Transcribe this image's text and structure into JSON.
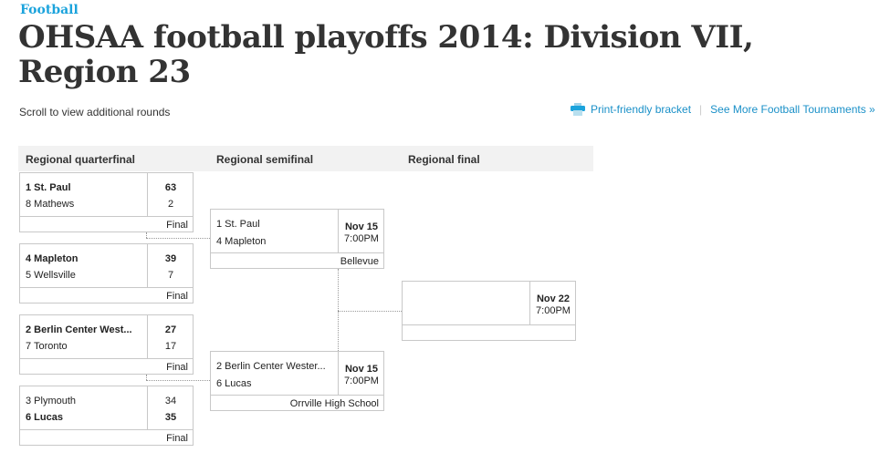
{
  "header": {
    "category": "Football",
    "title": "OHSAA football playoffs 2014: Division VII, Region 23",
    "scroll_note": "Scroll to view additional rounds",
    "print_link": "Print-friendly bracket",
    "more_link": "See More Football Tournaments »",
    "separator": "|"
  },
  "rounds": [
    "Regional quarterfinal",
    "Regional semifinal",
    "Regional final"
  ],
  "quarterfinals": [
    {
      "team1": "1 St. Paul",
      "score1": "63",
      "team2": "8 Mathews",
      "score2": "2",
      "status": "Final",
      "winner": 1
    },
    {
      "team1": "4 Mapleton",
      "score1": "39",
      "team2": "5 Wellsville",
      "score2": "7",
      "status": "Final",
      "winner": 1
    },
    {
      "team1": "2 Berlin Center West...",
      "score1": "27",
      "team2": "7 Toronto",
      "score2": "17",
      "status": "Final",
      "winner": 1
    },
    {
      "team1": "3 Plymouth",
      "score1": "34",
      "team2": "6 Lucas",
      "score2": "35",
      "status": "Final",
      "winner": 2
    }
  ],
  "semifinals": [
    {
      "team1": "1 St. Paul",
      "team2": "4 Mapleton",
      "date": "Nov 15",
      "time": "7:00PM",
      "location": "Bellevue"
    },
    {
      "team1": "2 Berlin Center Wester...",
      "team2": "6 Lucas",
      "date": "Nov 15",
      "time": "7:00PM",
      "location": "Orrville High School"
    }
  ],
  "final": {
    "team1": "",
    "team2": "",
    "date": "Nov 22",
    "time": "7:00PM",
    "location": ""
  },
  "colors": {
    "accent": "#1ba3dc",
    "link": "#1a90c8",
    "border": "#c8c8c8",
    "header_bg": "#f2f2f2"
  }
}
